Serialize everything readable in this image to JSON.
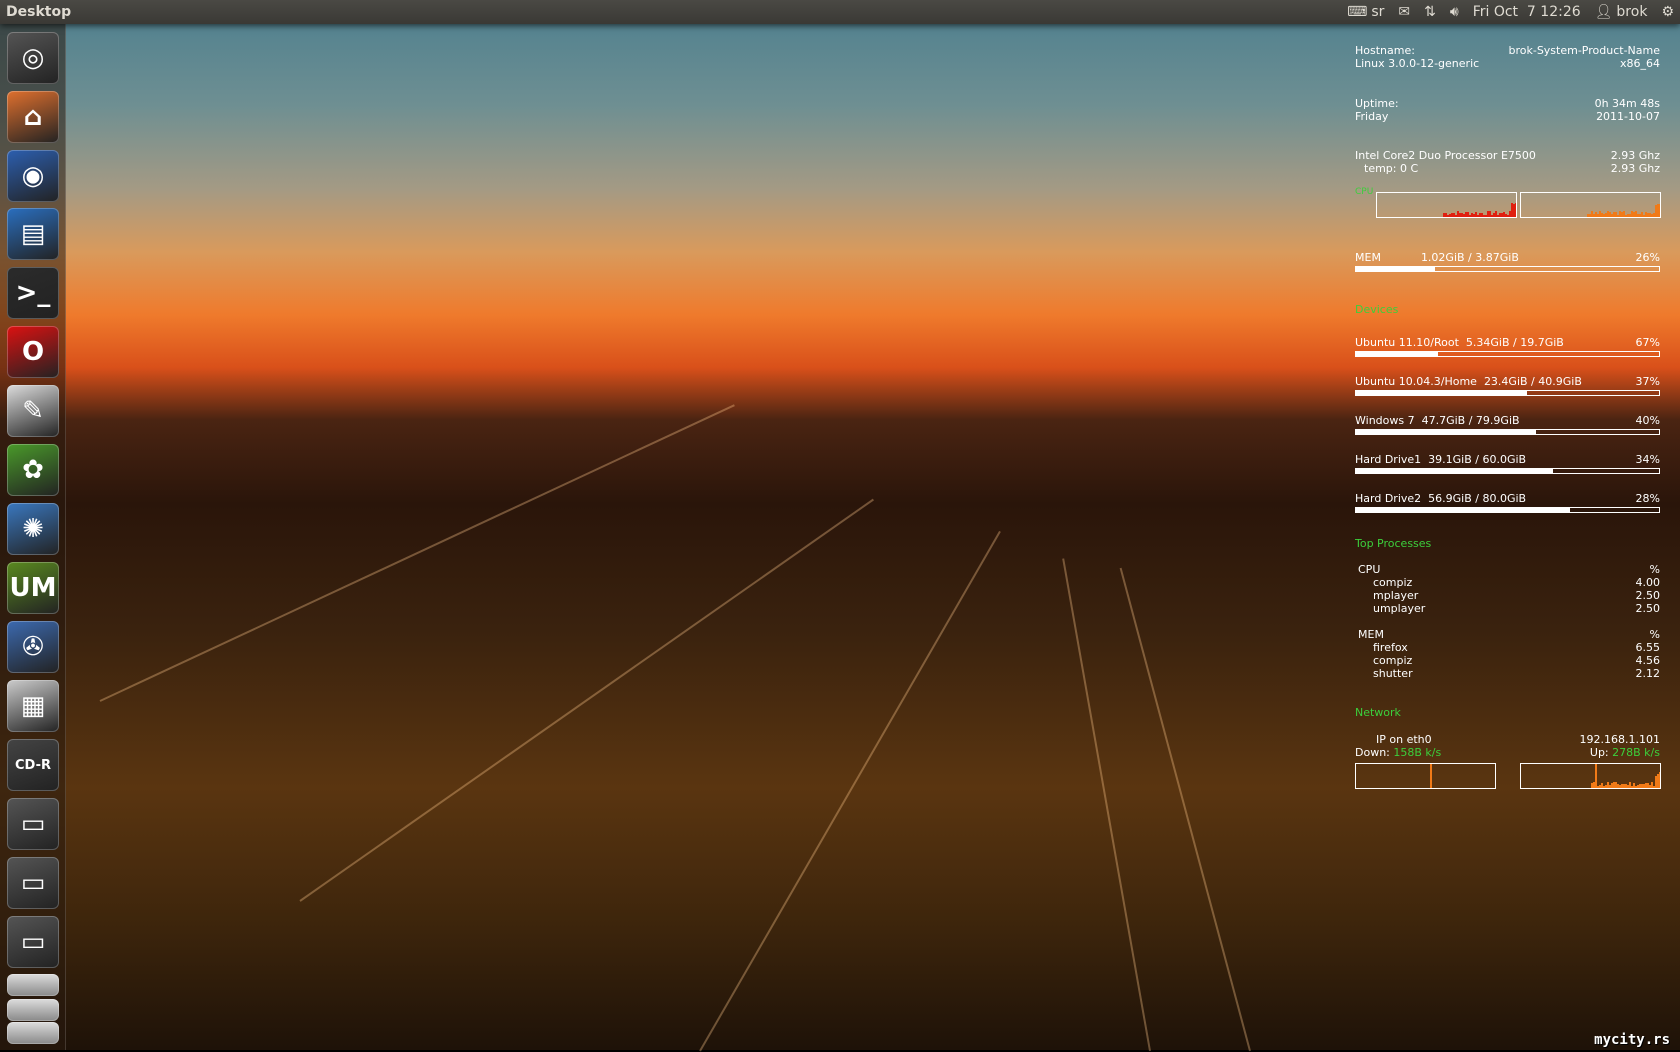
{
  "topbar": {
    "title": "Desktop",
    "keyboard_layout": "sr",
    "clock": "Fri Oct  7 12:26",
    "user": "brok"
  },
  "launcher": {
    "items": [
      {
        "name": "dash-home",
        "glyph": "◎",
        "color": "#555"
      },
      {
        "name": "home-folder",
        "glyph": "⌂",
        "color": "#e0702e"
      },
      {
        "name": "firefox",
        "glyph": "◉",
        "color": "#2c5fb0"
      },
      {
        "name": "libreoffice-writer",
        "glyph": "▤",
        "color": "#2a6fc0"
      },
      {
        "name": "terminal",
        "glyph": ">_",
        "color": "#2b2b2b"
      },
      {
        "name": "opera",
        "glyph": "O",
        "color": "#d11"
      },
      {
        "name": "text-editor",
        "glyph": "✎",
        "color": "#ddd"
      },
      {
        "name": "ubuntu-software",
        "glyph": "✿",
        "color": "#4a9a2a"
      },
      {
        "name": "shutter",
        "glyph": "✺",
        "color": "#3a78c0"
      },
      {
        "name": "umplayer",
        "glyph": "UM",
        "color": "#5a8a20"
      },
      {
        "name": "video-editor",
        "glyph": "✇",
        "color": "#3c6ab0"
      },
      {
        "name": "workspace-switcher",
        "glyph": "▦",
        "color": "#ccc"
      },
      {
        "name": "cd-r",
        "glyph": "CD-R",
        "color": "#444"
      },
      {
        "name": "drive-1",
        "glyph": "▭",
        "color": "#555"
      },
      {
        "name": "drive-2",
        "glyph": "▭",
        "color": "#555"
      },
      {
        "name": "drive-3",
        "glyph": "▭",
        "color": "#555"
      }
    ]
  },
  "conky": {
    "hostname_label": "Hostname:",
    "hostname": "brok-System-Product-Name",
    "kernel": "Linux 3.0.0-12-generic",
    "arch": "x86_64",
    "uptime_label": "Uptime:",
    "uptime": "0h 34m 48s",
    "day": "Friday",
    "date": "2011-10-07",
    "cpu_name": "Intel Core2 Duo Processor E7500",
    "cpu_freq1": "2.93 Ghz",
    "temp": "temp: 0 C",
    "cpu_freq2": "2.93 Ghz",
    "cpu_label": "CPU",
    "mem_label": "MEM",
    "mem_value": "1.02GiB / 3.87GiB",
    "mem_percent": "26%",
    "mem_fill": 0.26,
    "devices_label": "Devices",
    "devices": [
      {
        "name": "Ubuntu 11.10/Root",
        "usage": "5.34GiB / 19.7GiB",
        "percent": "67%",
        "fill": 0.27
      },
      {
        "name": "Ubuntu 10.04.3/Home",
        "usage": "23.4GiB / 40.9GiB",
        "percent": "37%",
        "fill": 0.565
      },
      {
        "name": "Windows 7",
        "usage": "47.7GiB / 79.9GiB",
        "percent": "40%",
        "fill": 0.595
      },
      {
        "name": "Hard Drive1",
        "usage": "39.1GiB / 60.0GiB",
        "percent": "34%",
        "fill": 0.65
      },
      {
        "name": "Hard Drive2",
        "usage": "56.9GiB / 80.0GiB",
        "percent": "28%",
        "fill": 0.705
      }
    ],
    "top_label": "Top Processes",
    "top_cpu_header": "CPU",
    "top_cpu_pct": "%",
    "top_cpu": [
      {
        "name": "compiz",
        "value": "4.00"
      },
      {
        "name": "mplayer",
        "value": "2.50"
      },
      {
        "name": "umplayer",
        "value": "2.50"
      }
    ],
    "top_mem_header": "MEM",
    "top_mem_pct": "%",
    "top_mem": [
      {
        "name": "firefox",
        "value": "6.55"
      },
      {
        "name": "compiz",
        "value": "4.56"
      },
      {
        "name": "shutter",
        "value": "2.12"
      }
    ],
    "network_label": "Network",
    "ip_label": "IP on eth0",
    "ip": "192.168.1.101",
    "down_label": "Down:",
    "down": "158B k/s",
    "up_label": "Up:",
    "up": "278B k/s"
  },
  "watermark": "mycity.rs",
  "colors": {
    "accent_green": "#3ccf3c",
    "graph_red": "#e02010",
    "graph_orange": "#f07a18"
  }
}
